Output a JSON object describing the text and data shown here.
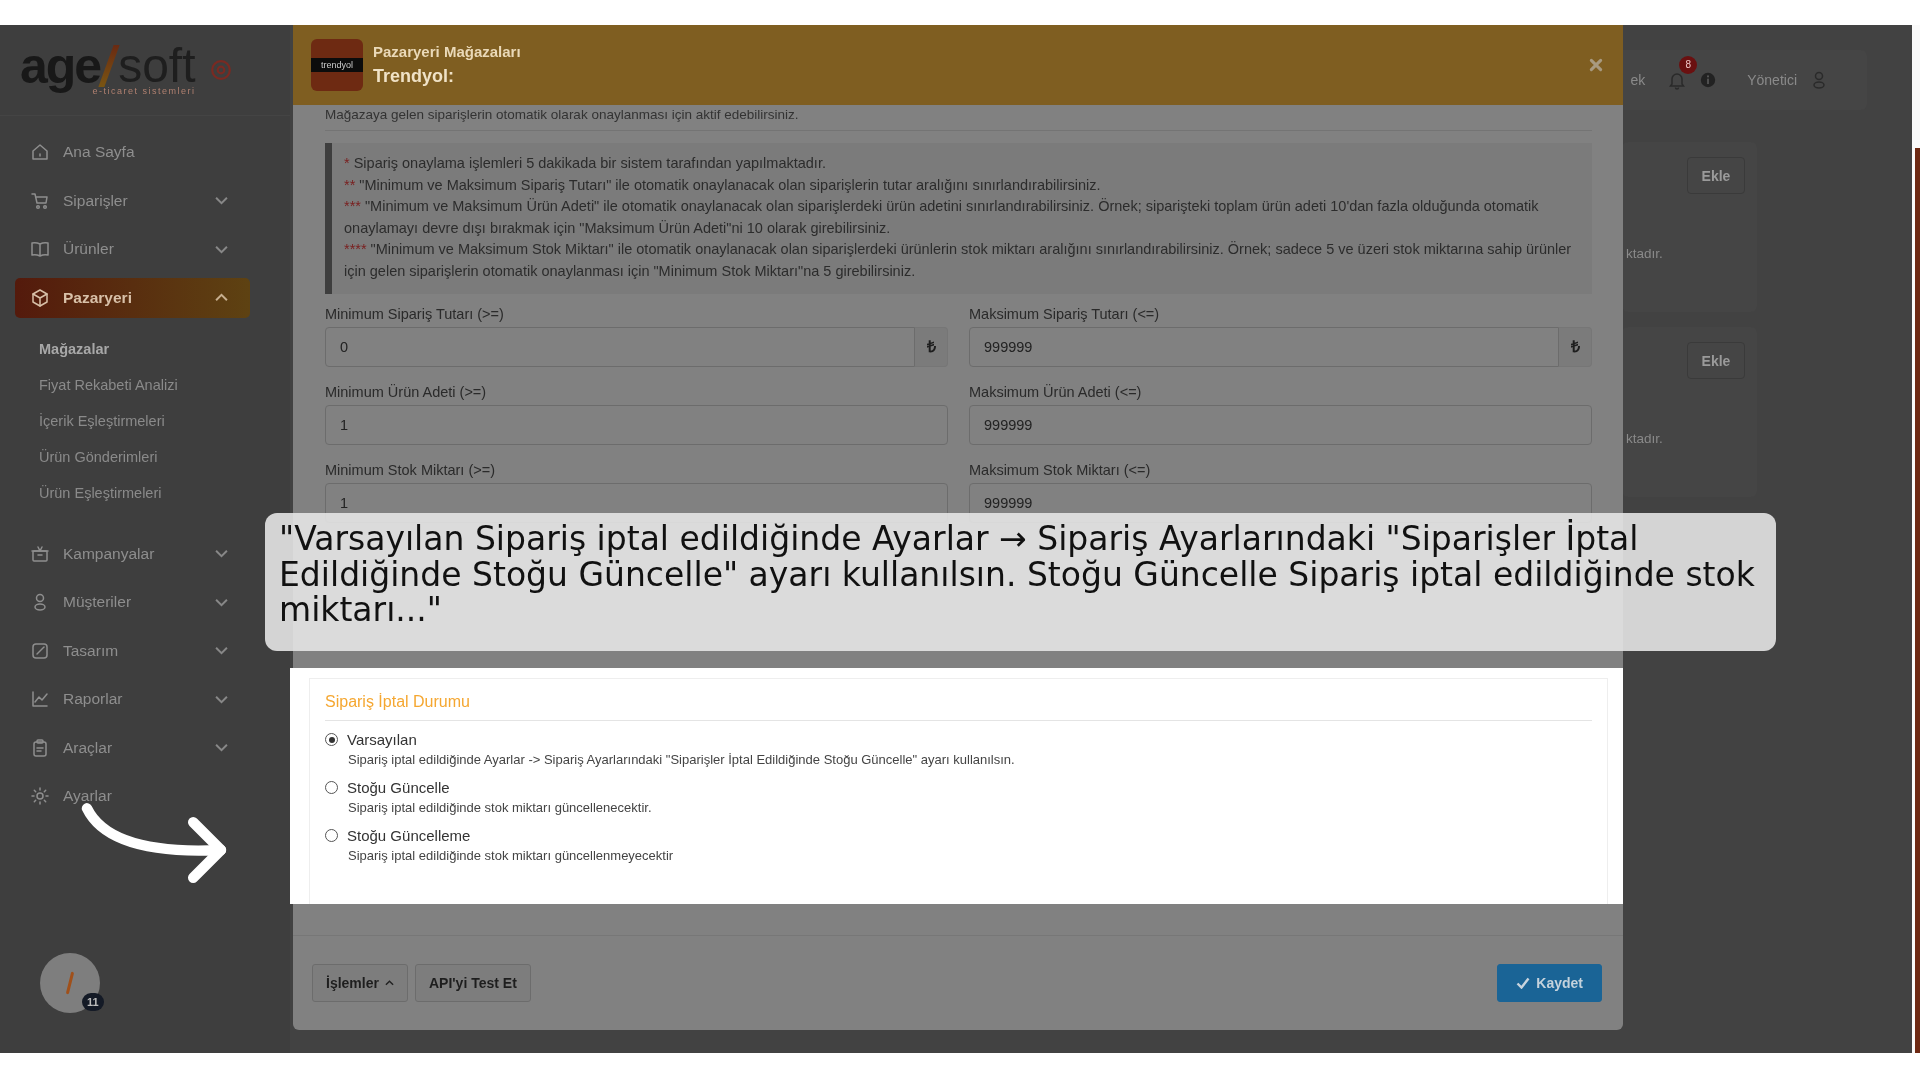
{
  "sidebar": {
    "logo": {
      "left": "age",
      "right": "soft",
      "tagline": "e-ticaret sistemleri"
    },
    "items": [
      {
        "label": "Ana Sayfa",
        "kind": "link",
        "selected": false
      },
      {
        "label": "Siparişler",
        "kind": "group",
        "expanded": false,
        "selected": false
      },
      {
        "label": "Ürünler",
        "kind": "group",
        "expanded": false,
        "selected": false
      },
      {
        "label": "Pazaryeri",
        "kind": "group",
        "expanded": true,
        "selected": true,
        "children": [
          {
            "label": "Mağazalar",
            "selected": true
          },
          {
            "label": "Fiyat Rekabeti Analizi",
            "selected": false
          },
          {
            "label": "İçerik Eşleştirmeleri",
            "selected": false
          },
          {
            "label": "Ürün Gönderimleri",
            "selected": false
          },
          {
            "label": "Ürün Eşleştirmeleri",
            "selected": false
          }
        ]
      },
      {
        "label": "Kampanyalar",
        "kind": "group",
        "expanded": false,
        "selected": false
      },
      {
        "label": "Müşteriler",
        "kind": "group",
        "expanded": false,
        "selected": false
      },
      {
        "label": "Tasarım",
        "kind": "group",
        "expanded": false,
        "selected": false
      },
      {
        "label": "Raporlar",
        "kind": "group",
        "expanded": false,
        "selected": false
      },
      {
        "label": "Araçlar",
        "kind": "group",
        "expanded": false,
        "selected": false
      },
      {
        "label": "Ayarlar",
        "kind": "link",
        "selected": false
      }
    ],
    "avatar": {
      "badge": "11"
    }
  },
  "header": {
    "partial_text": "ek",
    "notification_count": "8",
    "user": "Yönetici"
  },
  "background_cards": [
    {
      "button": "Ekle",
      "text": "ktadır."
    },
    {
      "button": "Ekle",
      "text": "ktadır."
    }
  ],
  "modal": {
    "logo_text": "trendyol",
    "subtitle": "Pazaryeri Mağazaları",
    "title": "Trendyol:",
    "intro": "Mağazaya gelen siparişlerin otomatik olarak onaylanması için aktif edebilirsiniz.",
    "notes": [
      {
        "marker": "*",
        "text": "Sipariş onaylama işlemleri 5 dakikada bir sistem tarafından yapılmaktadır."
      },
      {
        "marker": "**",
        "text": "\"Minimum ve Maksimum Sipariş Tutarı\" ile otomatik onaylanacak olan siparişlerin tutar aralığını sınırlandırabilirsiniz."
      },
      {
        "marker": "***",
        "text": "\"Minimum ve Maksimum Ürün Adeti\" ile otomatik onaylanacak olan siparişlerdeki ürün adetini sınırlandırabilirsiniz. Örnek; siparişteki toplam ürün adeti 10'dan fazla olduğunda otomatik onaylamayı devre dışı bırakmak için \"Maksimum Ürün Adeti\"ni 10 olarak girebilirsiniz."
      },
      {
        "marker": "****",
        "text": "\"Minimum ve Maksimum Stok Miktarı\" ile otomatik onaylanacak olan siparişlerdeki ürünlerin stok miktarı aralığını sınırlandırabilirsiniz. Örnek; sadece 5 ve üzeri stok miktarına sahip ürünler için gelen siparişlerin otomatik onaylanması için \"Minimum Stok Miktarı\"na 5 girebilirsiniz."
      }
    ],
    "fields": [
      {
        "label": "Minimum Sipariş Tutarı (>=)",
        "value": "0",
        "suffix": "₺"
      },
      {
        "label": "Maksimum Sipariş Tutarı (<=)",
        "value": "999999",
        "suffix": "₺"
      },
      {
        "label": "Minimum Ürün Adeti (>=)",
        "value": "1"
      },
      {
        "label": "Maksimum Ürün Adeti (<=)",
        "value": "999999"
      },
      {
        "label": "Minimum Stok Miktarı (>=)",
        "value": "1"
      },
      {
        "label": "Maksimum Stok Miktarı (<=)",
        "value": "999999"
      }
    ],
    "cancel_section": {
      "title": "Sipariş İptal Durumu",
      "options": [
        {
          "label": "Varsayılan",
          "description": "Sipariş iptal edildiğinde Ayarlar -> Sipariş Ayarlarındaki \"Siparişler İptal Edildiğinde Stoğu Güncelle\" ayarı kullanılsın.",
          "selected": true
        },
        {
          "label": "Stoğu Güncelle",
          "description": "Sipariş iptal edildiğinde stok miktarı güncellenecektir.",
          "selected": false
        },
        {
          "label": "Stoğu Güncelleme",
          "description": "Sipariş iptal edildiğinde stok miktarı güncellenmeyecektir",
          "selected": false
        }
      ]
    },
    "footer": {
      "buttons": [
        {
          "label": "İşlemler",
          "kind": "menu"
        },
        {
          "label": "API'yi Test Et",
          "kind": "plain"
        },
        {
          "label": "Kaydet",
          "kind": "primary"
        }
      ]
    }
  },
  "caption": {
    "text": "\"Varsayılan Sipariş iptal edildiğinde Ayarlar → Sipariş Ayarlarındaki \"Siparişler İptal Edildiğinde Stoğu Güncelle\" ayarı kullanılsın. Stoğu Güncelle Sipariş iptal edildiğinde stok miktarı...\""
  }
}
